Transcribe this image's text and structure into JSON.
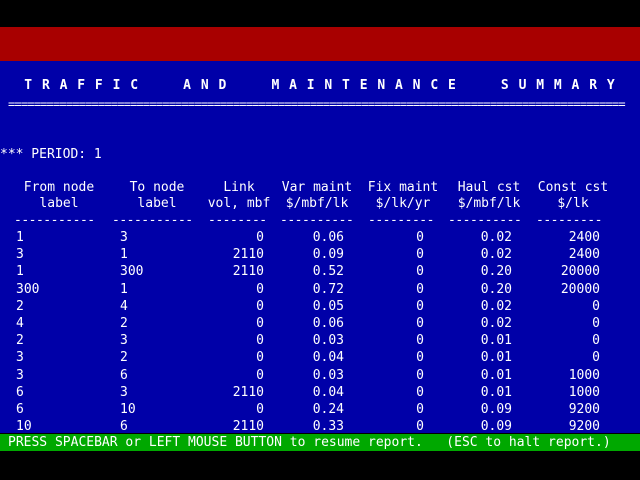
{
  "title": "T R A F F I C     A N D     M A I N T E N A N C E     S U M M A R Y",
  "rule": "================================================================================================",
  "period": "*** PERIOD: 1",
  "columns": [
    {
      "line1": "From node",
      "line2": "label",
      "dash": "-----------"
    },
    {
      "line1": "To node",
      "line2": "label",
      "dash": "-----------"
    },
    {
      "line1": "Link",
      "line2": "vol, mbf",
      "dash": "--------"
    },
    {
      "line1": "Var maint",
      "line2": "$/mbf/lk",
      "dash": "----------"
    },
    {
      "line1": "Fix maint",
      "line2": "$/lk/yr",
      "dash": "---------"
    },
    {
      "line1": "Haul cst",
      "line2": "$/mbf/lk",
      "dash": "----------"
    },
    {
      "line1": "Const cst",
      "line2": "$/lk",
      "dash": "---------"
    }
  ],
  "rows": [
    [
      "1",
      "3",
      "0",
      "0.06",
      "0",
      "0.02",
      "2400"
    ],
    [
      "3",
      "1",
      "2110",
      "0.09",
      "0",
      "0.02",
      "2400"
    ],
    [
      "1",
      "300",
      "2110",
      "0.52",
      "0",
      "0.20",
      "20000"
    ],
    [
      "300",
      "1",
      "0",
      "0.72",
      "0",
      "0.20",
      "20000"
    ],
    [
      "2",
      "4",
      "0",
      "0.05",
      "0",
      "0.02",
      "0"
    ],
    [
      "4",
      "2",
      "0",
      "0.06",
      "0",
      "0.02",
      "0"
    ],
    [
      "2",
      "3",
      "0",
      "0.03",
      "0",
      "0.01",
      "0"
    ],
    [
      "3",
      "2",
      "0",
      "0.04",
      "0",
      "0.01",
      "0"
    ],
    [
      "3",
      "6",
      "0",
      "0.03",
      "0",
      "0.01",
      "1000"
    ],
    [
      "6",
      "3",
      "2110",
      "0.04",
      "0",
      "0.01",
      "1000"
    ],
    [
      "6",
      "10",
      "0",
      "0.24",
      "0",
      "0.09",
      "9200"
    ],
    [
      "10",
      "6",
      "2110",
      "0.33",
      "0",
      "0.09",
      "9200"
    ]
  ],
  "status": "PRESS SPACEBAR or LEFT MOUSE BUTTON to resume report.   (ESC to halt report.)",
  "colors": {
    "background": "#0000a8",
    "top_bar": "#a80000",
    "status_bar": "#00a800",
    "text": "#ffffff"
  }
}
